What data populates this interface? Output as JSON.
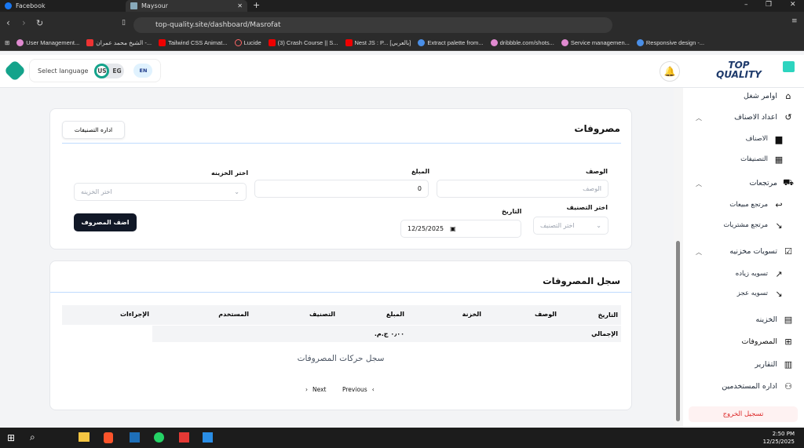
{
  "browser": {
    "tabs": [
      {
        "title": "Facebook"
      },
      {
        "title": "Maysour",
        "active": true
      }
    ],
    "url": "top-quality.site/dashboard/Masrofat",
    "bookmarks": [
      "User Management...",
      "الشيخ محمد عمران -...",
      "Tailwind CSS Animat...",
      "Lucide",
      "(3) Crash Course || S...",
      "Nest JS : P... [بالعربي]",
      "Extract palette from...",
      "dribbble.com/shots...",
      "Service managemen...",
      "Responsive design -..."
    ]
  },
  "header": {
    "select_language": "Select language",
    "lang_us": "US",
    "lang_eg": "EG",
    "lang_current": "EN"
  },
  "logo": {
    "text": "TOP QUALITY"
  },
  "sidebar": {
    "items": [
      {
        "label": "اوامر شغل",
        "icon": "home-icon"
      },
      {
        "label": "اعداد الاصناف",
        "icon": "refresh-icon",
        "expandable": true
      },
      {
        "label": "الاصناف",
        "icon": "box-icon",
        "sub": true
      },
      {
        "label": "التصنيفات",
        "icon": "grid-icon",
        "sub": true
      },
      {
        "label": "مرتجعات",
        "icon": "truck-icon",
        "expandable": true
      },
      {
        "label": "مرتجع مبيعات",
        "icon": "return-icon",
        "sub": true
      },
      {
        "label": "مرتجع مشتريات",
        "icon": "return-down-icon",
        "sub": true
      },
      {
        "label": "تسويات مخزنيه",
        "icon": "clipboard-check-icon",
        "expandable": true
      },
      {
        "label": "تسويه زياده",
        "icon": "trending-up-icon",
        "sub": true
      },
      {
        "label": "تسويه عجز",
        "icon": "trending-down-icon",
        "sub": true
      },
      {
        "label": "الخزينه",
        "icon": "safe-icon"
      },
      {
        "label": "المصروفات",
        "icon": "qr-icon"
      },
      {
        "label": "التقارير",
        "icon": "chart-icon"
      },
      {
        "label": "اداره المستخدمين",
        "icon": "users-icon"
      }
    ],
    "logout": "تسجيل الخروج"
  },
  "form": {
    "title": "مصروفات",
    "manage_categories": "اداره التصنيفات",
    "desc_label": "الوصف",
    "desc_placeholder": "الوصف",
    "amount_label": "المبلغ",
    "amount_value": "0",
    "treasury_label": "اختر الخزينه",
    "treasury_placeholder": "اختر الخزينه",
    "category_label": "اختر التصنيف",
    "category_placeholder": "اختر التصنيف",
    "date_label": "التاريخ",
    "date_value": "12/25/2025",
    "submit": "اضف المصروف"
  },
  "log": {
    "title": "سجل المصروفات",
    "columns": [
      "التاريخ",
      "الوصف",
      "الخزنة",
      "المبلغ",
      "التصنيف",
      "المستخدم",
      "الإجراءات"
    ],
    "total_label": "الإجمالي",
    "total_value": "٠٫٠٠ ج.م.",
    "empty": "سجل حركات المصروفات",
    "next": "Next",
    "previous": "Previous"
  },
  "taskbar": {
    "time": "2:50 PM",
    "date": "12/25/2025"
  }
}
